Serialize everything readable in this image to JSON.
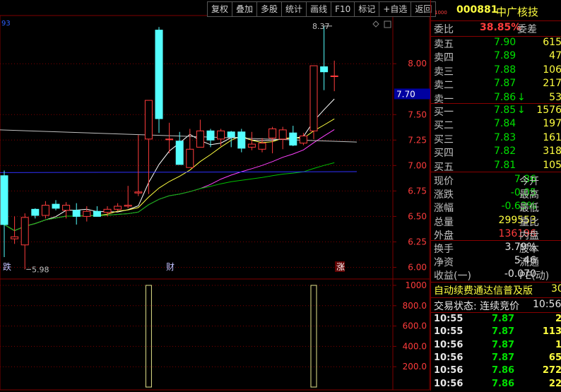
{
  "toolbar": {
    "buttons": [
      "复权",
      "叠加",
      "多股",
      "统计",
      "画线",
      "F10",
      "标记",
      "+自选",
      "返回"
    ]
  },
  "chart_labels": {
    "partial_left": "93",
    "high_marker": "8.37",
    "low_marker": "5.98",
    "current_price_tag": "7.70",
    "flags": [
      "跌",
      "财",
      "涨"
    ]
  },
  "chart_data": [
    {
      "type": "candlestick",
      "x": [
        "1",
        "2",
        "3",
        "4",
        "5",
        "6",
        "7",
        "8",
        "9",
        "10",
        "11",
        "12",
        "13",
        "14",
        "15",
        "16",
        "17",
        "18",
        "19",
        "20",
        "21",
        "22",
        "23",
        "24",
        "25",
        "26",
        "27",
        "28",
        "29",
        "30",
        "31",
        "32",
        "33"
      ],
      "open": [
        6.9,
        6.28,
        6.22,
        6.57,
        6.51,
        6.62,
        6.56,
        6.56,
        6.5,
        6.55,
        6.54,
        6.57,
        6.6,
        6.73,
        7.26,
        8.33,
        7.26,
        7.24,
        6.98,
        7.18,
        7.34,
        7.26,
        7.33,
        7.33,
        7.18,
        7.16,
        7.27,
        7.26,
        7.32,
        7.22,
        7.34,
        7.97,
        7.88
      ],
      "high": [
        6.95,
        6.5,
        6.53,
        6.58,
        6.65,
        6.66,
        6.64,
        6.63,
        6.6,
        6.6,
        6.6,
        6.63,
        6.8,
        7.3,
        7.61,
        8.36,
        7.42,
        7.33,
        7.36,
        7.45,
        7.36,
        7.36,
        7.34,
        7.36,
        7.33,
        7.27,
        7.38,
        7.38,
        7.39,
        7.32,
        7.47,
        8.37,
        8.03
      ],
      "low": [
        6.1,
        6.23,
        5.98,
        6.48,
        6.48,
        6.56,
        6.48,
        6.42,
        6.45,
        6.52,
        6.5,
        6.55,
        6.58,
        6.7,
        6.72,
        7.32,
        7.12,
        7.1,
        6.98,
        7.18,
        7.18,
        7.19,
        7.18,
        7.13,
        7.15,
        7.13,
        7.12,
        7.16,
        7.19,
        7.2,
        7.26,
        7.74,
        7.73
      ],
      "close": [
        6.42,
        6.3,
        6.49,
        6.51,
        6.61,
        6.58,
        6.61,
        6.5,
        6.55,
        6.5,
        6.57,
        6.6,
        6.61,
        6.74,
        7.64,
        7.46,
        7.26,
        7.01,
        7.16,
        7.34,
        7.25,
        7.34,
        7.28,
        7.17,
        7.21,
        7.22,
        7.36,
        7.35,
        7.2,
        7.29,
        7.98,
        7.92,
        7.88
      ],
      "y_ticks": [
        6.0,
        6.25,
        6.5,
        6.75,
        7.0,
        7.25,
        7.5,
        8.0
      ],
      "ylim": [
        5.92,
        8.48
      ]
    },
    {
      "type": "bar",
      "x": [
        "1",
        "2",
        "3",
        "4",
        "5",
        "6",
        "7",
        "8",
        "9",
        "10",
        "11",
        "12",
        "13",
        "14",
        "15",
        "16",
        "17",
        "18",
        "19",
        "20",
        "21",
        "22",
        "23",
        "24",
        "25",
        "26",
        "27",
        "28",
        "29",
        "30",
        "31",
        "32",
        "33"
      ],
      "values": [
        0,
        0,
        0,
        0,
        0,
        0,
        0,
        0,
        0,
        0,
        0,
        0,
        0,
        0,
        1000,
        0,
        0,
        0,
        0,
        0,
        0,
        0,
        0,
        0,
        0,
        0,
        0,
        0,
        0,
        0,
        1000,
        0,
        0
      ],
      "y_ticks": [
        "1000",
        "800.0",
        "600.0",
        "400.0",
        "200.0"
      ],
      "ylim": [
        0,
        1000
      ]
    }
  ],
  "stock": {
    "code": "000881",
    "name": "中广核技",
    "prefix": "1000"
  },
  "order_ratio": {
    "label": "委比",
    "value": "38.85%",
    "label2": "委差"
  },
  "sell": [
    {
      "label": "卖五",
      "price": "7.90",
      "vol": "615",
      "mark": ""
    },
    {
      "label": "卖四",
      "price": "7.89",
      "vol": "47",
      "mark": ""
    },
    {
      "label": "卖三",
      "price": "7.88",
      "vol": "106",
      "mark": ""
    },
    {
      "label": "卖二",
      "price": "7.87",
      "vol": "217",
      "mark": ""
    },
    {
      "label": "卖一",
      "price": "7.86",
      "vol": "53",
      "mark": "↓"
    }
  ],
  "buy": [
    {
      "label": "买一",
      "price": "7.85",
      "vol": "1576",
      "mark": "↓"
    },
    {
      "label": "买二",
      "price": "7.84",
      "vol": "197",
      "mark": ""
    },
    {
      "label": "买三",
      "price": "7.83",
      "vol": "161",
      "mark": ""
    },
    {
      "label": "买四",
      "price": "7.82",
      "vol": "318",
      "mark": ""
    },
    {
      "label": "买五",
      "price": "7.81",
      "vol": "105",
      "mark": ""
    }
  ],
  "quote": [
    {
      "label": "现价",
      "value": "7.86",
      "label2": "今开",
      "cls": "grn"
    },
    {
      "label": "涨跌",
      "value": "-0.05",
      "label2": "最高",
      "cls": "grn"
    },
    {
      "label": "涨幅",
      "value": "-0.63%",
      "label2": "最低",
      "cls": "grn"
    },
    {
      "label": "总量",
      "value": "299553",
      "label2": "量比",
      "cls": "yel"
    },
    {
      "label": "外盘",
      "value": "136196",
      "label2": "内盘",
      "cls": "red"
    }
  ],
  "stats": [
    {
      "label": "换手",
      "value": "3.79%",
      "label2": "股本"
    },
    {
      "label": "净资",
      "value": "5.46",
      "label2": "流通"
    },
    {
      "label": "收益(一)",
      "value": "-0.070",
      "label2": "PE(动)"
    }
  ],
  "banner": {
    "text": "自动续费通达信普及版",
    "right": "30"
  },
  "trade_status": {
    "text": "交易状态: 连续竞价",
    "time": "10:56:"
  },
  "ticks": [
    {
      "time": "10:55",
      "price": "7.87",
      "vol": "2"
    },
    {
      "time": "10:55",
      "price": "7.87",
      "vol": "113"
    },
    {
      "time": "10:56",
      "price": "7.87",
      "vol": "1"
    },
    {
      "time": "10:56",
      "price": "7.87",
      "vol": "65"
    },
    {
      "time": "10:56",
      "price": "7.86",
      "vol": "272"
    },
    {
      "time": "10:56",
      "price": "7.86",
      "vol": "22"
    }
  ],
  "colors": {
    "up": "#ff3c3c",
    "down": "#54ffff",
    "volume": "#e6e68c",
    "grid": "#800000"
  }
}
